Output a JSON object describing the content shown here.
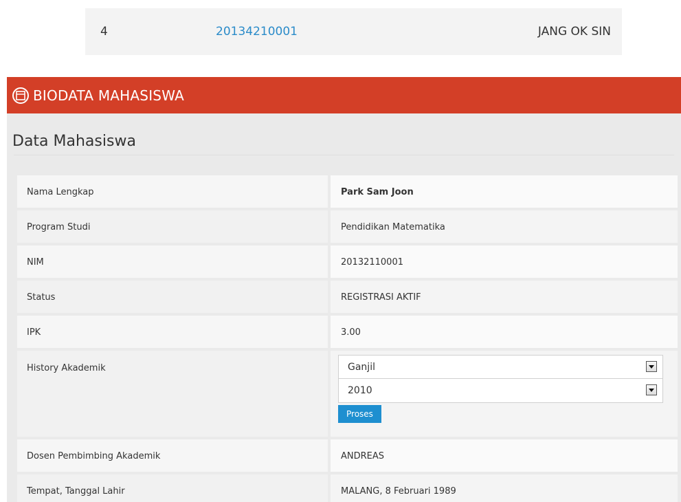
{
  "top_row": {
    "number": "4",
    "nim": "20134210001",
    "name": "JANG OK SIN"
  },
  "panel": {
    "header_title": "BIODATA MAHASISWA",
    "header_icon": "table-icon",
    "section_title": "Data Mahasiswa",
    "accent_color": "#d33f27"
  },
  "fields": {
    "nama_label": "Nama Lengkap",
    "nama_value": "Park Sam Joon",
    "prodi_label": "Program Studi",
    "prodi_value": "Pendidikan Matematika",
    "nim_label": "NIM",
    "nim_value": "20132110001",
    "status_label": "Status",
    "status_value": "REGISTRASI AKTIF",
    "ipk_label": "IPK",
    "ipk_value": "3.00",
    "history_label": "History Akademik",
    "semester_selected": "Ganjil",
    "year_selected": "2010",
    "proses_label": "Proses",
    "dosen_label": "Dosen Pembimbing Akademik",
    "dosen_value": "ANDREAS",
    "ttl_label": "Tempat, Tanggal Lahir",
    "ttl_value": "MALANG, 8 Februari 1989"
  }
}
